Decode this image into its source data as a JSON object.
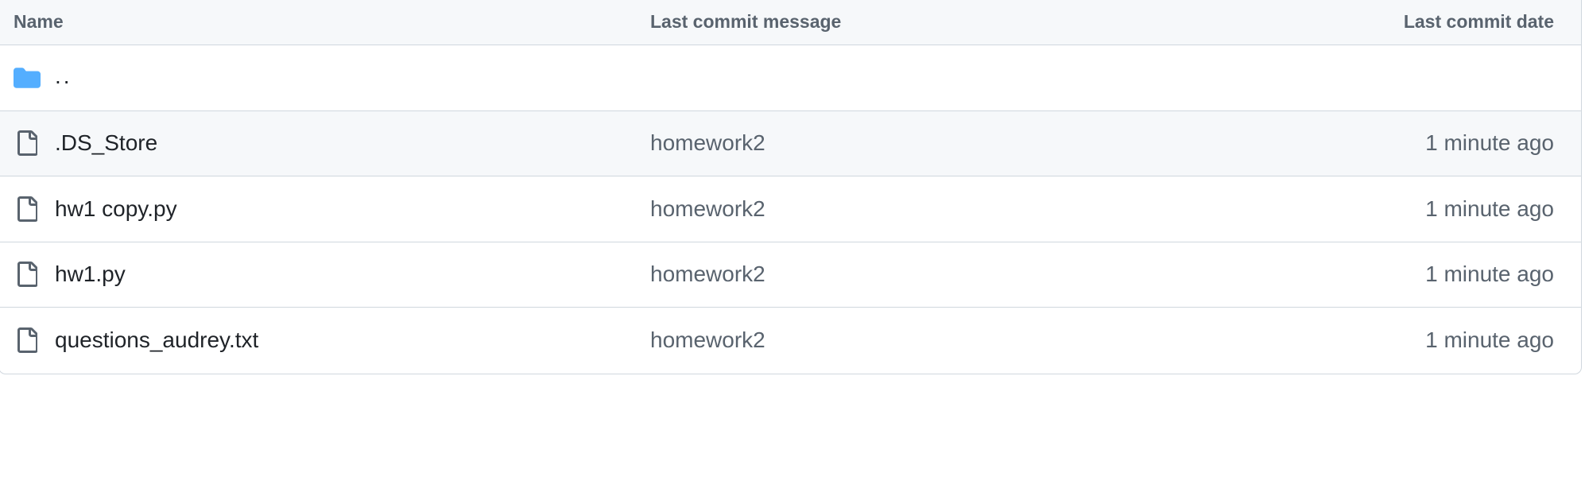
{
  "table": {
    "headers": {
      "name": "Name",
      "message": "Last commit message",
      "date": "Last commit date"
    },
    "parent": {
      "icon": "folder-icon",
      "label": "..",
      "color": "#54aeff"
    },
    "rows": [
      {
        "name": ".DS_Store",
        "message": "homework2",
        "date": "1 minute ago",
        "icon": "file-icon"
      },
      {
        "name": "hw1 copy.py",
        "message": "homework2",
        "date": "1 minute ago",
        "icon": "file-icon"
      },
      {
        "name": "hw1.py",
        "message": "homework2",
        "date": "1 minute ago",
        "icon": "file-icon"
      },
      {
        "name": "questions_audrey.txt",
        "message": "homework2",
        "date": "1 minute ago",
        "icon": "file-icon"
      }
    ]
  }
}
